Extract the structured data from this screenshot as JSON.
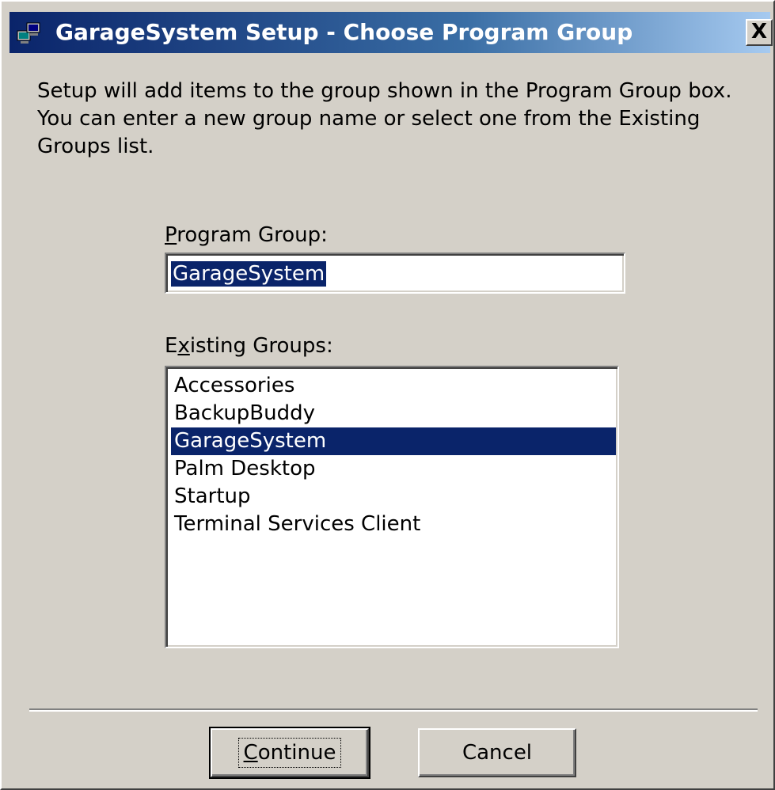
{
  "window": {
    "title": "GarageSystem Setup - Choose Program Group",
    "close_glyph": "X",
    "app_icon": "setup-computer-icon"
  },
  "intro": {
    "line1": "Setup will add items to the group shown in the Program Group box.",
    "line2": "You can enter a new group name or select one from the Existing",
    "line3": "Groups list."
  },
  "program_group": {
    "label_mnemonic": "P",
    "label_rest": "rogram Group:",
    "value": "GarageSystem"
  },
  "existing_groups": {
    "label_before": "E",
    "label_mnemonic": "x",
    "label_rest": "isting Groups:",
    "items": [
      "Accessories",
      "BackupBuddy",
      "GarageSystem",
      "Palm Desktop",
      "Startup",
      "Terminal Services Client"
    ],
    "selected": "GarageSystem"
  },
  "buttons": {
    "continue_mnemonic": "C",
    "continue_rest": "ontinue",
    "cancel": "Cancel"
  },
  "colors": {
    "dialog_bg": "#d4d0c8",
    "selection": "#0a246a",
    "titlebar_start": "#0a246a",
    "titlebar_end": "#a6caf0"
  }
}
